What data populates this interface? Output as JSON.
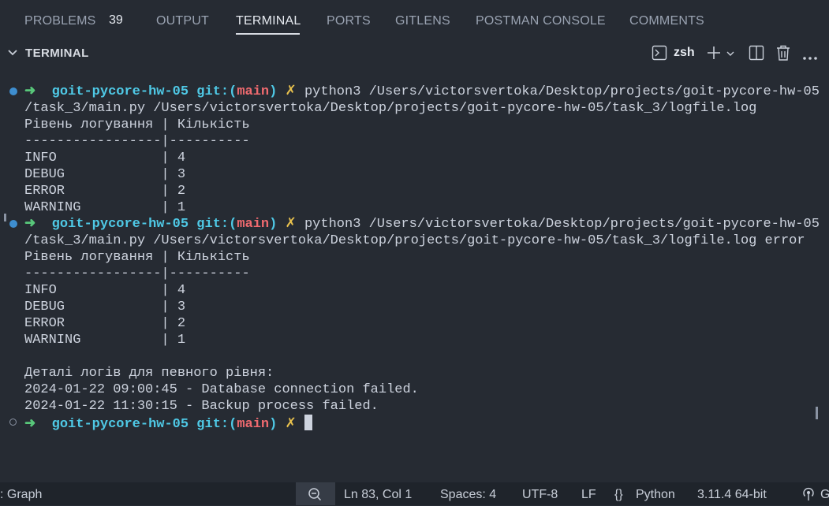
{
  "tabs": [
    {
      "label": "PROBLEMS",
      "count": "39"
    },
    {
      "label": "OUTPUT"
    },
    {
      "label": "TERMINAL",
      "active": true
    },
    {
      "label": "PORTS"
    },
    {
      "label": "GITLENS"
    },
    {
      "label": "POSTMAN CONSOLE"
    },
    {
      "label": "COMMENTS"
    }
  ],
  "panel": {
    "title": "TERMINAL",
    "shell": "zsh"
  },
  "terminal": {
    "prompt_repo": "goit-pycore-hw-05",
    "prompt_git": "git:",
    "prompt_branch_open": "(",
    "prompt_branch": "main",
    "prompt_branch_close": ")",
    "prompt_x": "✗",
    "arrow": "➜",
    "cmd1_a": "python3 /Users/victorsvertoka/Desktop/projects/goit-pycore-hw-05",
    "cmd1_b": "/task_3/main.py /Users/victorsvertoka/Desktop/projects/goit-pycore-hw-05/task_3/logfile.log",
    "cmd2_a": "python3 /Users/victorsvertoka/Desktop/projects/goit-pycore-hw-05",
    "cmd2_b": "/task_3/main.py /Users/victorsvertoka/Desktop/projects/goit-pycore-hw-05/task_3/logfile.log error",
    "table_header": "Рівень логування | Кількість",
    "table_sep": "-----------------|----------",
    "table_rows": [
      "INFO             | 4",
      "DEBUG            | 3",
      "ERROR            | 2",
      "WARNING          | 1"
    ],
    "details_title": "Деталі логів для певного рівня:",
    "details": [
      "2024-01-22 09:00:45 - Database connection failed.",
      "2024-01-22 11:30:15 - Backup process failed."
    ]
  },
  "status_bar": {
    "left": ": Graph",
    "position": "Ln 83, Col 1",
    "spaces": "Spaces: 4",
    "encoding": "UTF-8",
    "eol": "LF",
    "language_glyph": "{}",
    "language": "Python",
    "interpreter": "3.11.4 64-bit",
    "right_cut": "G"
  },
  "colors": {
    "background": "#262b33",
    "arrow": "#58c77a",
    "repo": "#4fc9e6",
    "branch": "#ef6a6f",
    "x": "#e8c14d"
  }
}
